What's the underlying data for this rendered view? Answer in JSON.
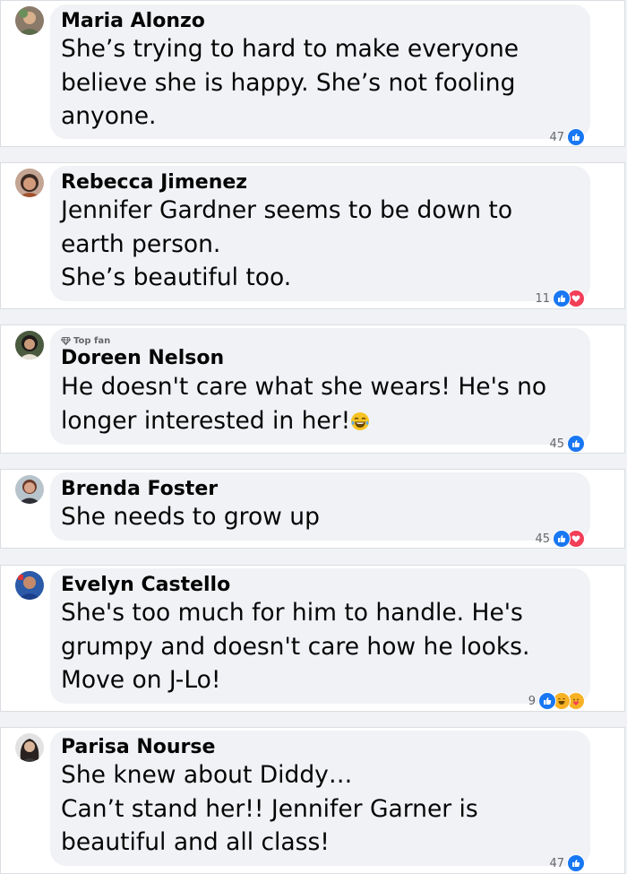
{
  "comments": [
    {
      "name": "Maria Alonzo",
      "lines": [
        "She’s trying to hard to make everyone",
        "believe she is happy. She’s not fooling",
        "anyone."
      ],
      "reaction_count": "47",
      "reactions": [
        "like-icon"
      ]
    },
    {
      "name": "Rebecca Jimenez",
      "lines": [
        "Jennifer Gardner seems to be down to",
        "earth person.",
        "She’s beautiful too."
      ],
      "reaction_count": "11",
      "reactions": [
        "like-icon",
        "love-icon"
      ]
    },
    {
      "badge": "Top fan",
      "name": "Doreen Nelson",
      "lines": [
        "He doesn't care what she wears! He's no",
        "longer interested in her!"
      ],
      "emoji": "laughing-tears-emoji",
      "reaction_count": "45",
      "reactions": [
        "like-icon"
      ]
    },
    {
      "name": "Brenda Foster",
      "lines": [
        "She needs to grow up"
      ],
      "reaction_count": "45",
      "reactions": [
        "like-icon",
        "love-icon"
      ]
    },
    {
      "name": "Evelyn Castello",
      "lines": [
        "She's too much for him to handle. He's",
        "grumpy and doesn't care how he looks.",
        "Move on J-Lo!"
      ],
      "reaction_count": "9",
      "reactions": [
        "like-icon",
        "haha-icon",
        "care-icon"
      ]
    },
    {
      "name": "Parisa Nourse",
      "lines": [
        "She knew about Diddy…",
        "Can’t stand her!! Jennifer Garner is",
        "beautiful and all class!"
      ],
      "reaction_count": "47",
      "reactions": [
        "like-icon"
      ]
    }
  ],
  "colors": {
    "like": "#1877f2",
    "love": "#f33e58",
    "haha": "#f7b125",
    "bubble": "#f0f2f5"
  }
}
